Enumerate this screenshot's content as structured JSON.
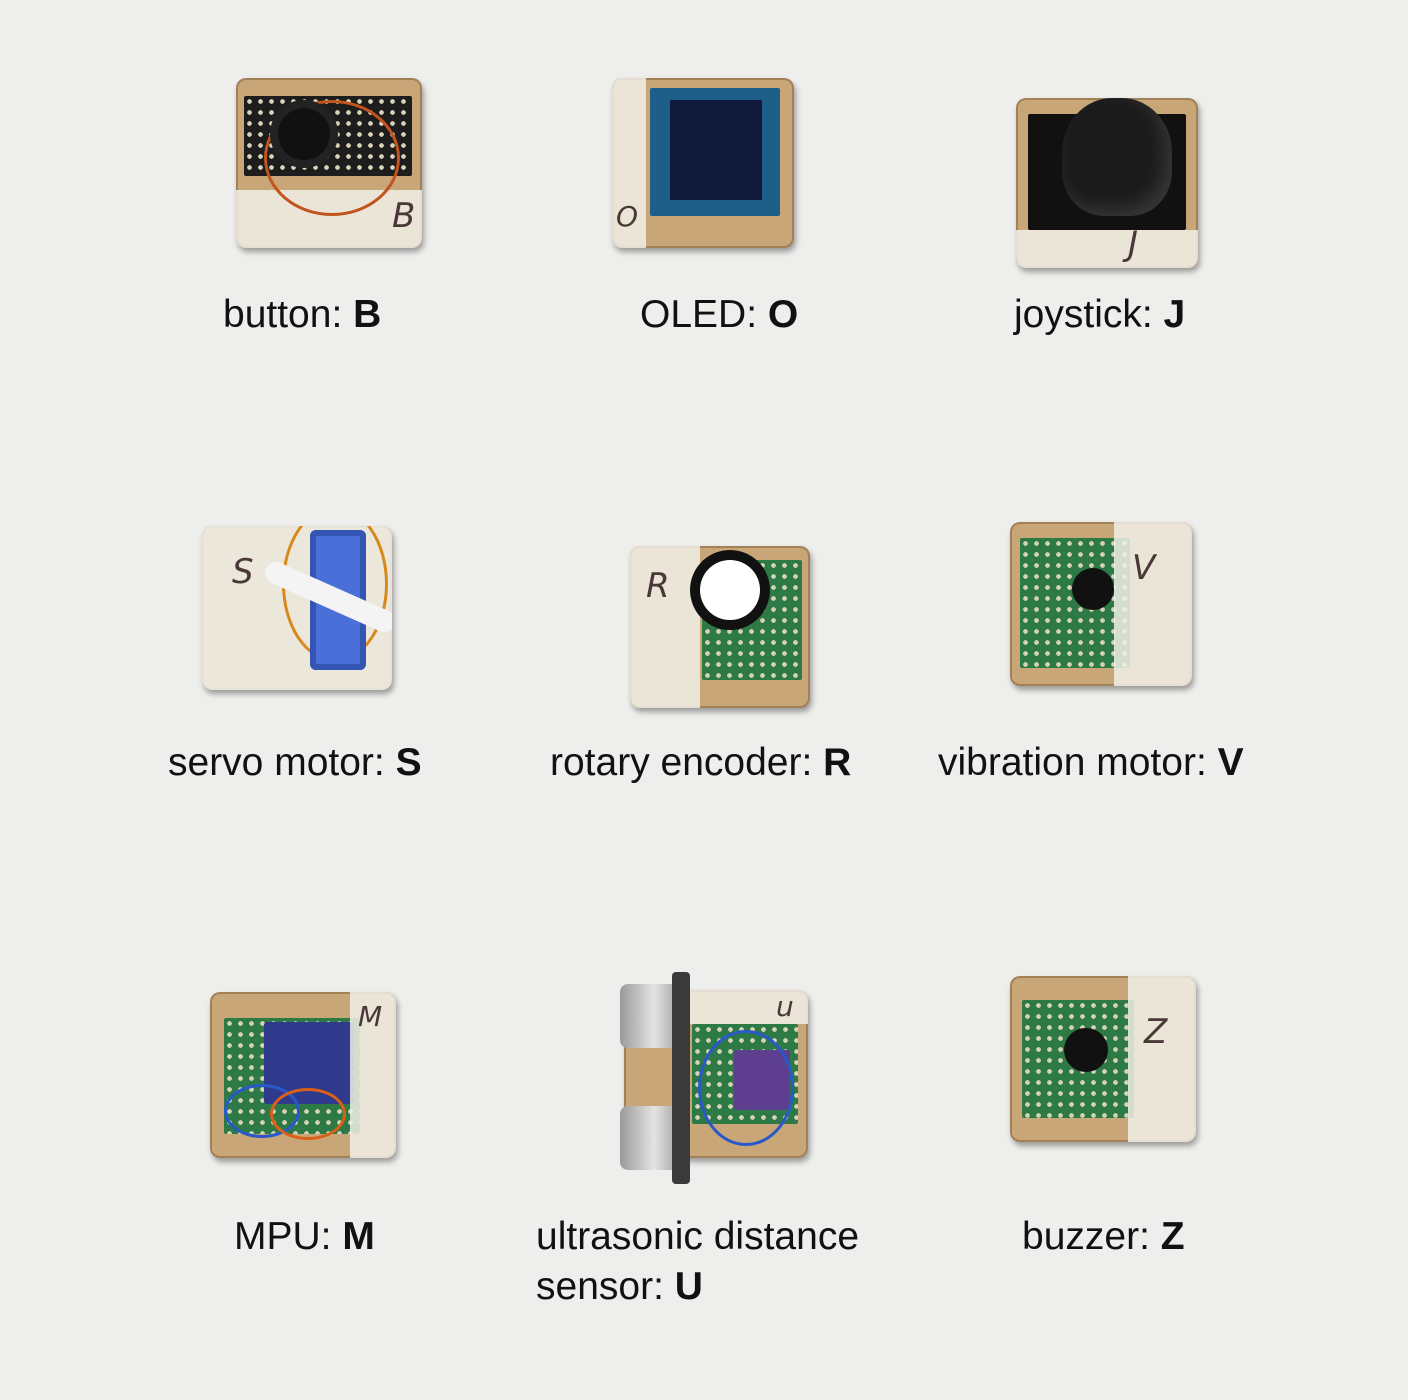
{
  "modules": [
    {
      "name": "button",
      "key": "B"
    },
    {
      "name": "OLED",
      "key": "O"
    },
    {
      "name": "joystick",
      "key": "J"
    },
    {
      "name": "servo motor",
      "key": "S"
    },
    {
      "name": "rotary encoder",
      "key": "R"
    },
    {
      "name": "vibration motor",
      "key": "V"
    },
    {
      "name": "MPU",
      "key": "M"
    },
    {
      "name": "ultrasonic distance",
      "name_line2": "sensor",
      "key": "U"
    },
    {
      "name": "buzzer",
      "key": "Z"
    }
  ],
  "colors": {
    "background": "#eeeeec",
    "wood": "#c9a678",
    "pcb": "#2e7a47"
  }
}
